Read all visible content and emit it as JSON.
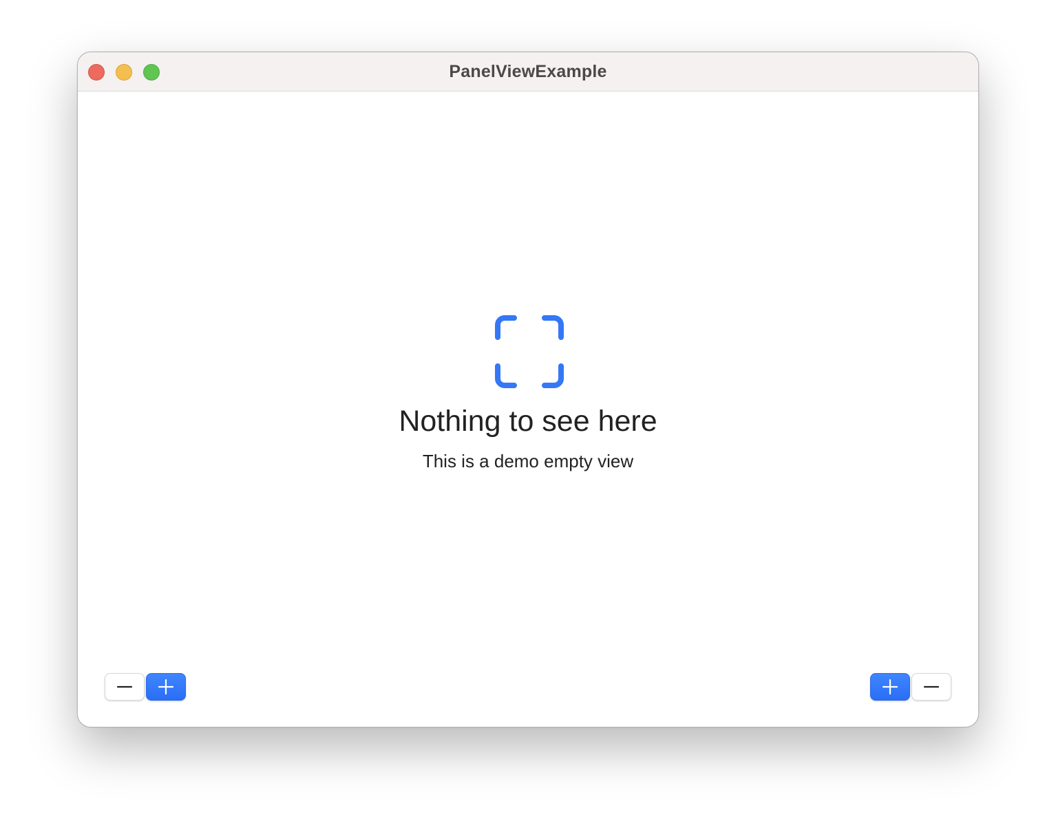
{
  "window": {
    "title": "PanelViewExample"
  },
  "empty_state": {
    "icon": "viewfinder-icon",
    "title": "Nothing to see here",
    "subtitle": "This is a demo empty view"
  },
  "left_controls": [
    {
      "icon": "minus-icon",
      "style": "white"
    },
    {
      "icon": "plus-icon",
      "style": "blue"
    }
  ],
  "right_controls": [
    {
      "icon": "plus-icon",
      "style": "blue"
    },
    {
      "icon": "minus-icon",
      "style": "white"
    }
  ],
  "colors": {
    "accent": "#3478f6",
    "close": "#ec6a5e",
    "minimize": "#f4bf4f",
    "zoom": "#61c554"
  }
}
